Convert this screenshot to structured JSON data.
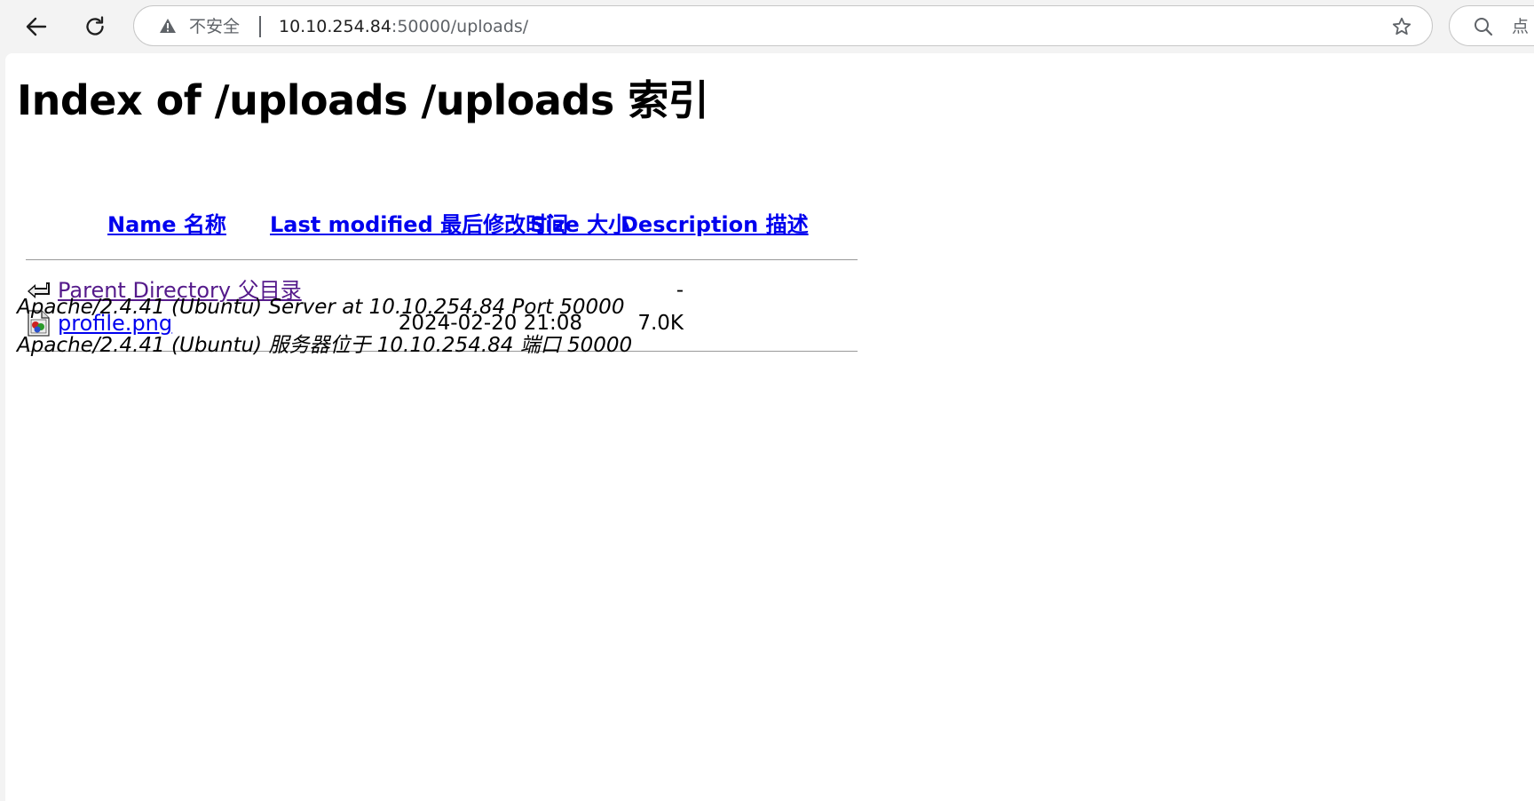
{
  "browser": {
    "security_label": "不安全",
    "url_host": "10.10.254.84",
    "url_rest": ":50000/uploads/",
    "search_partial_text": "点"
  },
  "page": {
    "title": "Index of /uploads  /uploads 索引",
    "columns": {
      "name": "Name  名称",
      "last_modified": "Last modified  最后修改时间",
      "size": "Size  大小",
      "description": "Description  描述"
    },
    "rows": [
      {
        "name": "Parent Directory  父目录",
        "date": "",
        "size": "-",
        "icon": "back-arrow-icon",
        "visited": true
      },
      {
        "name": "profile.png",
        "date": "2024-02-20 21:08",
        "size": "7.0K",
        "icon": "image-file-icon",
        "visited": false
      }
    ],
    "address_en": "Apache/2.4.41 (Ubuntu) Server at 10.10.254.84 Port 50000",
    "address_zh": "Apache/2.4.41 (Ubuntu) 服务器位于 10.10.254.84 端口 50000"
  },
  "colors": {
    "link": "#0000ee",
    "visited_link": "#551a8b",
    "toolbar_bg": "#f3f3f3"
  }
}
